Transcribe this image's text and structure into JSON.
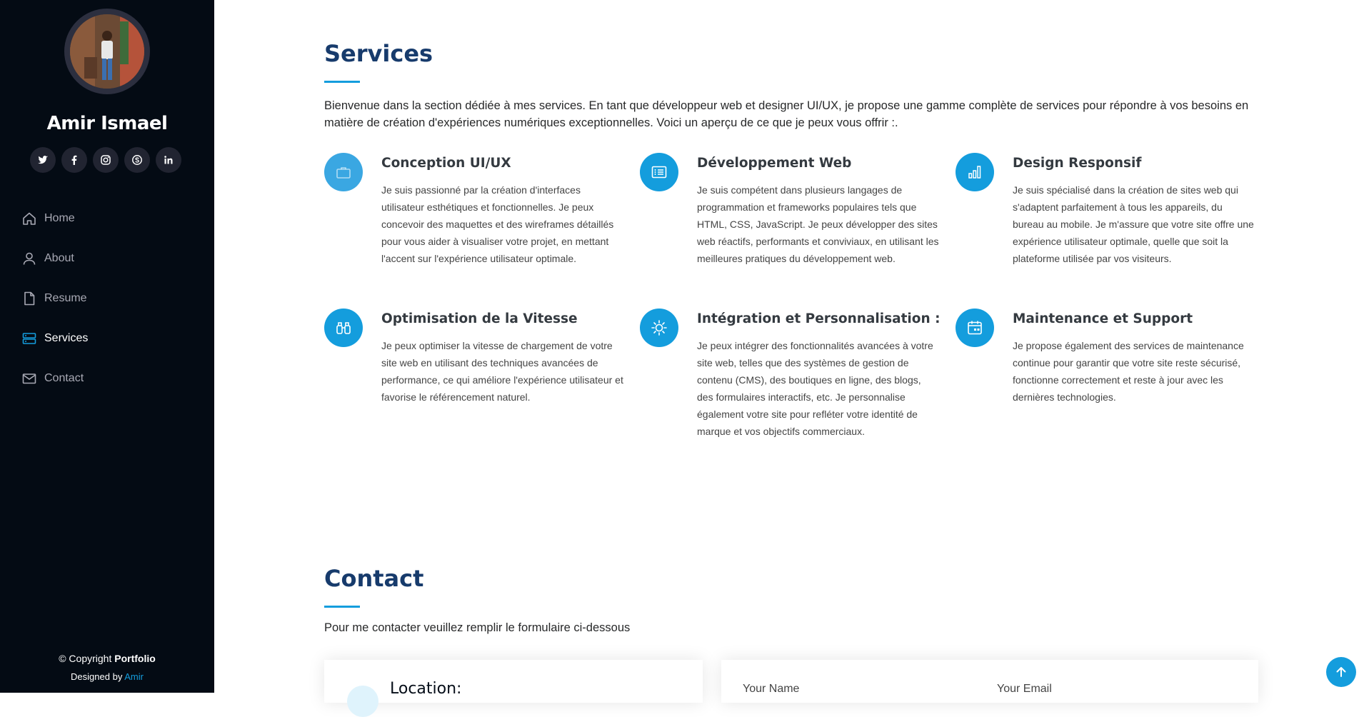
{
  "sidebar": {
    "name": "Amir Ismael",
    "socials": [
      {
        "name": "twitter-icon"
      },
      {
        "name": "facebook-icon"
      },
      {
        "name": "instagram-icon"
      },
      {
        "name": "skype-icon"
      },
      {
        "name": "linkedin-icon"
      }
    ],
    "nav": [
      {
        "label": "Home",
        "icon": "home-icon"
      },
      {
        "label": "About",
        "icon": "person-icon"
      },
      {
        "label": "Resume",
        "icon": "file-icon"
      },
      {
        "label": "Services",
        "icon": "server-icon",
        "active": true
      },
      {
        "label": "Contact",
        "icon": "envelope-icon"
      }
    ],
    "copyright_prefix": "© Copyright",
    "copyright_brand": "Portfolio",
    "designed_prefix": "Designed by",
    "designed_author": "Amir"
  },
  "services": {
    "title": "Services",
    "intro": "Bienvenue dans la section dédiée à mes services. En tant que développeur web et designer UI/UX, je propose une gamme complète de services pour répondre à vos besoins en matière de création d'expériences numériques exceptionnelles. Voici un aperçu de ce que je peux vous offrir :.",
    "items": [
      {
        "title": "Conception UI/UX",
        "icon": "briefcase-icon",
        "text": "Je suis passionné par la création d'interfaces utilisateur esthétiques et fonctionnelles. Je peux concevoir des maquettes et des wireframes détaillés pour vous aider à visualiser votre projet, en mettant l'accent sur l'expérience utilisateur optimale."
      },
      {
        "title": "Développement Web",
        "icon": "card-list-icon",
        "text": "Je suis compétent dans plusieurs langages de programmation et frameworks populaires tels que HTML, CSS, JavaScript. Je peux développer des sites web réactifs, performants et conviviaux, en utilisant les meilleures pratiques du développement web."
      },
      {
        "title": "Design Responsif",
        "icon": "bar-chart-icon",
        "text": "Je suis spécialisé dans la création de sites web qui s'adaptent parfaitement à tous les appareils, du bureau au mobile. Je m'assure que votre site offre une expérience utilisateur optimale, quelle que soit la plateforme utilisée par vos visiteurs."
      },
      {
        "title": "Optimisation de la Vitesse",
        "icon": "binoculars-icon",
        "text": "Je peux optimiser la vitesse de chargement de votre site web en utilisant des techniques avancées de performance, ce qui améliore l'expérience utilisateur et favorise le référencement naturel."
      },
      {
        "title": "Intégration et Personnalisation :",
        "icon": "sun-icon",
        "text": "Je peux intégrer des fonctionnalités avancées à votre site web, telles que des systèmes de gestion de contenu (CMS), des boutiques en ligne, des blogs, des formulaires interactifs, etc. Je personnalise également votre site pour refléter votre identité de marque et vos objectifs commerciaux."
      },
      {
        "title": "Maintenance et Support",
        "icon": "calendar-icon",
        "text": "Je propose également des services de maintenance continue pour garantir que votre site reste sécurisé, fonctionne correctement et reste à jour avec les dernières technologies."
      }
    ]
  },
  "contact": {
    "title": "Contact",
    "intro": "Pour me contacter veuillez remplir le formulaire ci-dessous",
    "location_title": "Location:",
    "name_label": "Your Name",
    "email_label": "Your Email"
  },
  "colors": {
    "accent": "#149ddd",
    "title": "#173b6c",
    "sidebar_bg": "#040b14"
  }
}
